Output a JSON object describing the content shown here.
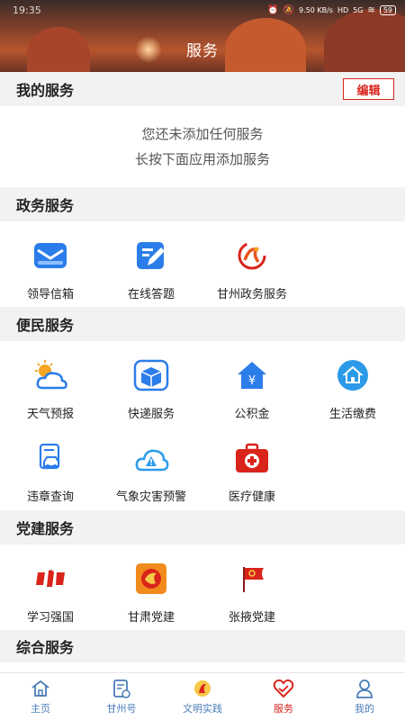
{
  "status_bar": {
    "time": "19:35",
    "speed": "9.50 KB/s",
    "hd": "HD",
    "signal": "5G",
    "battery": "59"
  },
  "header": {
    "title": "服务"
  },
  "my_services": {
    "title": "我的服务",
    "edit_label": "编辑",
    "empty_line1": "您还未添加任何服务",
    "empty_line2": "长按下面应用添加服务"
  },
  "gov_services": {
    "title": "政务服务",
    "items": [
      {
        "label": "领导信箱",
        "icon": "mail-icon"
      },
      {
        "label": "在线答题",
        "icon": "edit-icon"
      },
      {
        "label": "甘州政务服务",
        "icon": "gov-logo-icon"
      }
    ]
  },
  "public_services": {
    "title": "便民服务",
    "items": [
      {
        "label": "天气预报",
        "icon": "weather-icon"
      },
      {
        "label": "快递服务",
        "icon": "package-icon"
      },
      {
        "label": "公积金",
        "icon": "housing-fund-icon"
      },
      {
        "label": "生活缴费",
        "icon": "home-payment-icon"
      },
      {
        "label": "违章查询",
        "icon": "car-violation-icon"
      },
      {
        "label": "气象灾害预警",
        "icon": "weather-warning-icon"
      },
      {
        "label": "医疗健康",
        "icon": "medical-kit-icon"
      }
    ]
  },
  "party_services": {
    "title": "党建服务",
    "items": [
      {
        "label": "学习强国",
        "icon": "xuexi-logo-icon"
      },
      {
        "label": "甘肃党建",
        "icon": "gansu-party-logo-icon"
      },
      {
        "label": "张掖党建",
        "icon": "party-flag-icon"
      }
    ]
  },
  "comprehensive_services": {
    "title": "综合服务"
  },
  "tabbar": {
    "items": [
      {
        "label": "主页",
        "icon": "home-icon",
        "active": false
      },
      {
        "label": "甘州号",
        "icon": "account-icon",
        "active": false
      },
      {
        "label": "文明实践",
        "icon": "civilization-icon",
        "active": false
      },
      {
        "label": "服务",
        "icon": "heart-service-icon",
        "active": true
      },
      {
        "label": "我的",
        "icon": "user-icon",
        "active": false
      }
    ]
  },
  "colors": {
    "accent": "#d9241c",
    "blue": "#1e88e5",
    "tab_blue": "#4a7db8",
    "background": "#f2f2f2"
  }
}
